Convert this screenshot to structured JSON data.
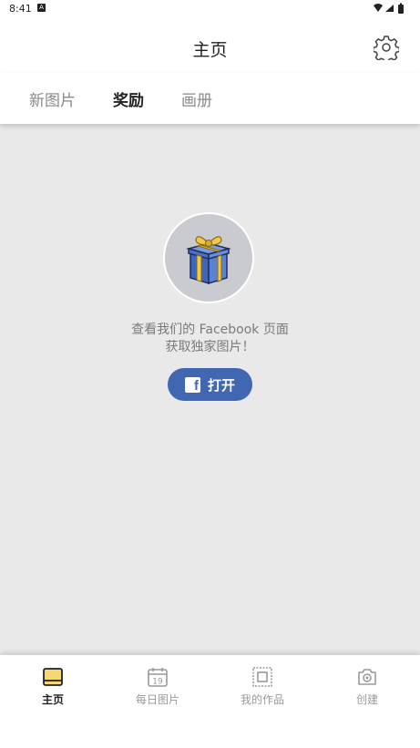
{
  "status_bar": {
    "time": "8:41"
  },
  "header": {
    "title": "主页"
  },
  "tabs": [
    {
      "label": "新图片"
    },
    {
      "label": "奖励"
    },
    {
      "label": "画册"
    }
  ],
  "reward": {
    "message_line1": "查看我们的 Facebook 页面",
    "message_line2": "获取独家图片！",
    "open_label": "打开"
  },
  "bottom_nav": [
    {
      "label": "主页"
    },
    {
      "label": "每日图片",
      "icon_number": "19"
    },
    {
      "label": "我的作品"
    },
    {
      "label": "创建"
    }
  ],
  "colors": {
    "facebook_blue": "#4267b2",
    "active_nav_icon": "#f7d774",
    "background": "#e9e9e9"
  }
}
